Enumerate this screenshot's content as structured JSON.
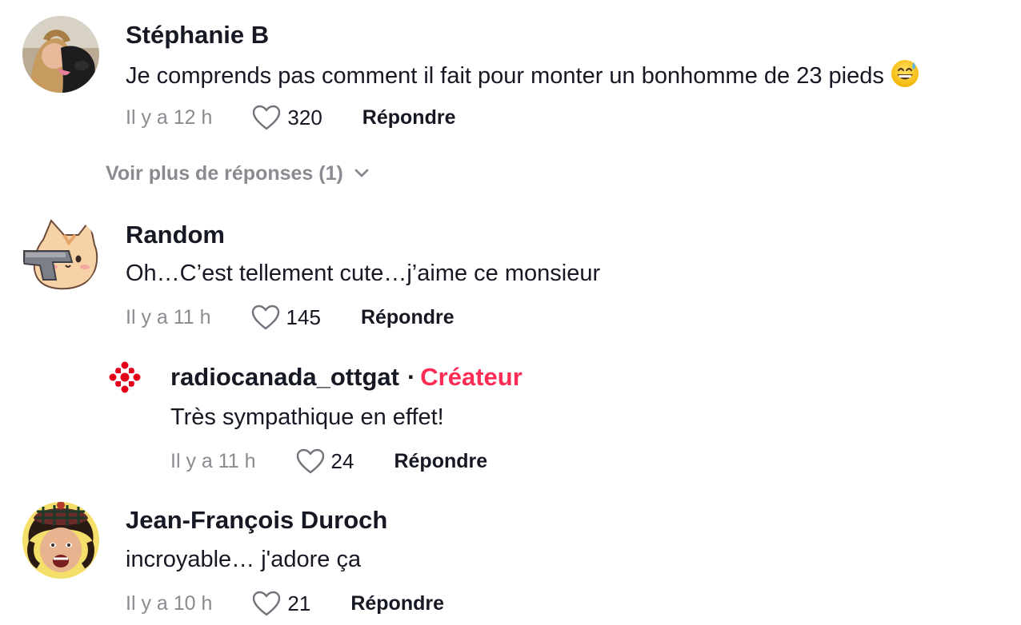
{
  "comments": [
    {
      "username": "Stéphanie B",
      "text": "Je comprends pas comment il fait pour monter un bonhomme de 23 pieds",
      "emoji_icon": "grinning-sweat-emoji-icon",
      "time": "Il y a 12 h",
      "likes": "320",
      "reply_label": "Répondre"
    },
    {
      "username": "Random",
      "text": "Oh…C’est tellement cute…j’aime ce monsieur",
      "time": "Il y a 11 h",
      "likes": "145",
      "reply_label": "Répondre"
    },
    {
      "username": "Jean-François Duroch",
      "text": "incroyable… j'adore ça",
      "time": "Il y a 10 h",
      "likes": "21",
      "reply_label": "Répondre"
    }
  ],
  "more_replies": {
    "label": "Voir plus de réponses (1)",
    "icon": "chevron-down-icon"
  },
  "reply": {
    "username": "radiocanada_ottgat",
    "separator": "·",
    "badge": "Créateur",
    "text": "Très sympathique en effet!",
    "time": "Il y a 11 h",
    "likes": "24",
    "reply_label": "Répondre"
  },
  "colors": {
    "text": "#161823",
    "muted": "#8a8b91",
    "creator": "#fe2c55",
    "brand_logo": "#e3001b"
  },
  "icons": {
    "like": "heart-outline-icon",
    "reply_avatar": "radio-canada-logo-icon"
  }
}
